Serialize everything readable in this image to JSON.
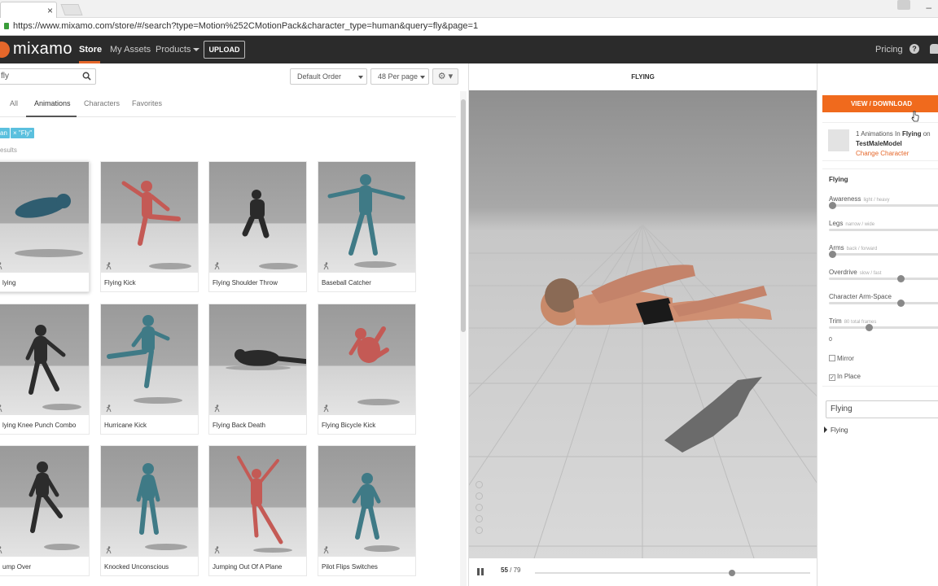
{
  "browser": {
    "url": "https://www.mixamo.com/store/#/search?type=Motion%252CMotionPack&character_type=human&query=fly&page=1",
    "close_glyph": "×",
    "minimize_glyph": "–"
  },
  "nav": {
    "logo": "mixamo",
    "items": [
      {
        "label": "Store",
        "active": true
      },
      {
        "label": "My Assets",
        "active": false
      },
      {
        "label": "Products",
        "active": false
      }
    ],
    "upload_label": "UPLOAD",
    "pricing_label": "Pricing",
    "help_glyph": "?",
    "accent_color": "#e5672a"
  },
  "toolbar": {
    "search_value": "fly",
    "order_select": "Default Order",
    "per_page_select": "48 Per page",
    "gear_glyph": "⚙ ▾"
  },
  "filters": {
    "tabs": [
      "All",
      "Animations",
      "Characters",
      "Favorites"
    ],
    "active_tab": "Animations",
    "chips": [
      "an",
      "× \"Fly\""
    ],
    "results_text": "esults"
  },
  "grid": [
    {
      "label": "lying",
      "selected": true
    },
    {
      "label": "Flying Kick",
      "selected": false
    },
    {
      "label": "Flying Shoulder Throw",
      "selected": false
    },
    {
      "label": "Baseball Catcher",
      "selected": false
    },
    {
      "label": "lying Knee Punch Combo",
      "selected": false
    },
    {
      "label": "Hurricane Kick",
      "selected": false
    },
    {
      "label": "Flying Back Death",
      "selected": false
    },
    {
      "label": "Flying Bicycle Kick",
      "selected": false
    },
    {
      "label": "ump Over",
      "selected": false
    },
    {
      "label": "Knocked Unconscious",
      "selected": false
    },
    {
      "label": "Jumping Out Of A Plane",
      "selected": false
    },
    {
      "label": "Pilot Flips Switches",
      "selected": false
    }
  ],
  "viewer": {
    "title": "FLYING",
    "current_frame": "55",
    "frame_total": "/ 79",
    "progress": 0.72
  },
  "panel": {
    "download_label": "VIEW / DOWNLOAD",
    "info": {
      "count_text": "1 Animations In",
      "pack": "Flying",
      "on_text": "on",
      "character": "TestMaleModel",
      "change_link": "Change Character"
    },
    "params_title": "Flying",
    "params": [
      {
        "label": "Awareness",
        "hint": "light / heavy",
        "value": 0.0
      },
      {
        "label": "Legs",
        "hint": "narrow / wide",
        "value": null
      },
      {
        "label": "Arms",
        "hint": "back / forward",
        "value": 0.0
      },
      {
        "label": "Overdrive",
        "hint": "slow / fast",
        "value": 0.64
      },
      {
        "label": "Character Arm-Space",
        "hint": "",
        "value": 0.64
      },
      {
        "label": "Trim",
        "hint": "80 total frames",
        "value": 0.34
      }
    ],
    "trim_start": "0",
    "mirror_label": "Mirror",
    "mirror_checked": false,
    "in_place_label": "In Place",
    "in_place_checked": true,
    "pack_name": "Flying",
    "tree_item": "Flying",
    "download_color": "#f06a1d"
  }
}
